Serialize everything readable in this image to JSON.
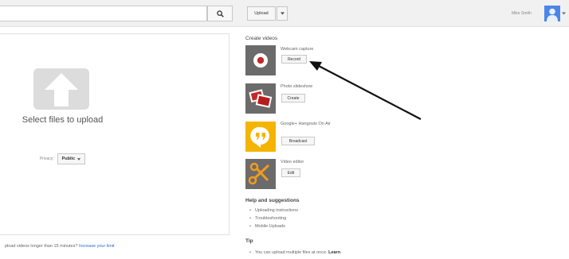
{
  "header": {
    "search_placeholder": "",
    "upload_label": "Upload",
    "username": "Mike Smith"
  },
  "upload_panel": {
    "select_files": "Select files to upload",
    "privacy_label": "Privacy:",
    "privacy_value": "Public"
  },
  "footer_note": {
    "text": "pload videos longer than 15 minutes? ",
    "link": "Increase your limit"
  },
  "create": {
    "title": "Create videos",
    "items": [
      {
        "label": "Webcam capture",
        "button": "Record",
        "icon": "webcam-record-icon"
      },
      {
        "label": "Photo slideshow",
        "button": "Create",
        "icon": "photo-slideshow-icon"
      },
      {
        "label": "Google+ Hangouts On Air",
        "button": "Broadcast",
        "icon": "hangouts-icon"
      },
      {
        "label": "Video editor",
        "button": "Edit",
        "icon": "scissors-icon"
      }
    ]
  },
  "help": {
    "title": "Help and suggestions",
    "links": [
      "Uploading instructions",
      "Troubleshooting",
      "Mobile Uploads"
    ]
  },
  "tip": {
    "title": "Tip",
    "text": "You can upload multiple files at once. ",
    "link": "Learn"
  },
  "colors": {
    "accent_red": "#c62828",
    "hangouts_yellow": "#f4b400",
    "scissors_orange": "#f29b1e",
    "avatar_blue": "#4a86e8",
    "link_blue": "#2a6bd1"
  }
}
